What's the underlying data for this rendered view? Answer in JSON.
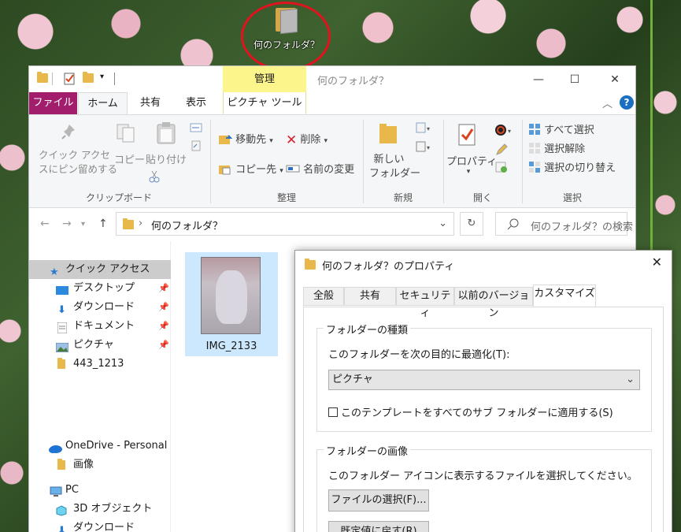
{
  "desktop": {
    "icon_label": "何のフォルダ？"
  },
  "window": {
    "manage_tab": "管理",
    "title": "何のフォルダ？",
    "controls": {
      "minimize": "—",
      "maximize": "☐",
      "close": "✕"
    }
  },
  "ribbon_tabs": {
    "file": "ファイル",
    "home": "ホーム",
    "share": "共有",
    "view": "表示",
    "picture_tools": "ピクチャ ツール"
  },
  "ribbon": {
    "clipboard": {
      "pin_line1": "クイック アクセ",
      "pin_line2": "スにピン留めする",
      "copy": "コピー",
      "paste": "貼り付け",
      "label": "クリップボード"
    },
    "organize": {
      "move_to": "移動先",
      "copy_to": "コピー先",
      "delete": "削除",
      "rename": "名前の変更",
      "label": "整理"
    },
    "new": {
      "new_folder_line1": "新しい",
      "new_folder_line2": "フォルダー",
      "label": "新規"
    },
    "open": {
      "properties": "プロパティ",
      "label": "開く"
    },
    "select": {
      "select_all": "すべて選択",
      "select_none": "選択解除",
      "invert": "選択の切り替え",
      "label": "選択"
    }
  },
  "address": {
    "path": "何のフォルダ？",
    "search_placeholder": "何のフォルダ？の検索"
  },
  "nav": {
    "quick_access": "クイック アクセス",
    "desktop": "デスクトップ",
    "downloads": "ダウンロード",
    "documents": "ドキュメント",
    "pictures": "ピクチャ",
    "folder_443": "443_1213",
    "onedrive": "OneDrive - Personal",
    "images": "画像",
    "pc": "PC",
    "objects3d": "3D オブジェクト",
    "pc_downloads": "ダウンロード"
  },
  "content": {
    "file_name": "IMG_2133"
  },
  "dialog": {
    "title": "何のフォルダ？のプロパティ",
    "close": "✕",
    "tabs": [
      "全般",
      "共有",
      "セキュリティ",
      "以前のバージョン",
      "カスタマイズ"
    ],
    "folder_type": {
      "legend": "フォルダーの種類",
      "optimize_label": "このフォルダーを次の目的に最適化(T):",
      "optimize_value": "ピクチャ",
      "apply_template": "このテンプレートをすべてのサブ フォルダーに適用する(S)"
    },
    "folder_picture": {
      "legend": "フォルダーの画像",
      "description": "このフォルダー アイコンに表示するファイルを選択してください。",
      "choose_file": "ファイルの選択(F)...",
      "restore_default": "既定値に戻す(R)"
    }
  },
  "colors": {
    "file_tab": "#a21e6c",
    "manage_tab": "#fcf58c",
    "selection": "#cce8ff",
    "highlight_ellipse": "#e0131f",
    "help": "#1b6fc3"
  }
}
